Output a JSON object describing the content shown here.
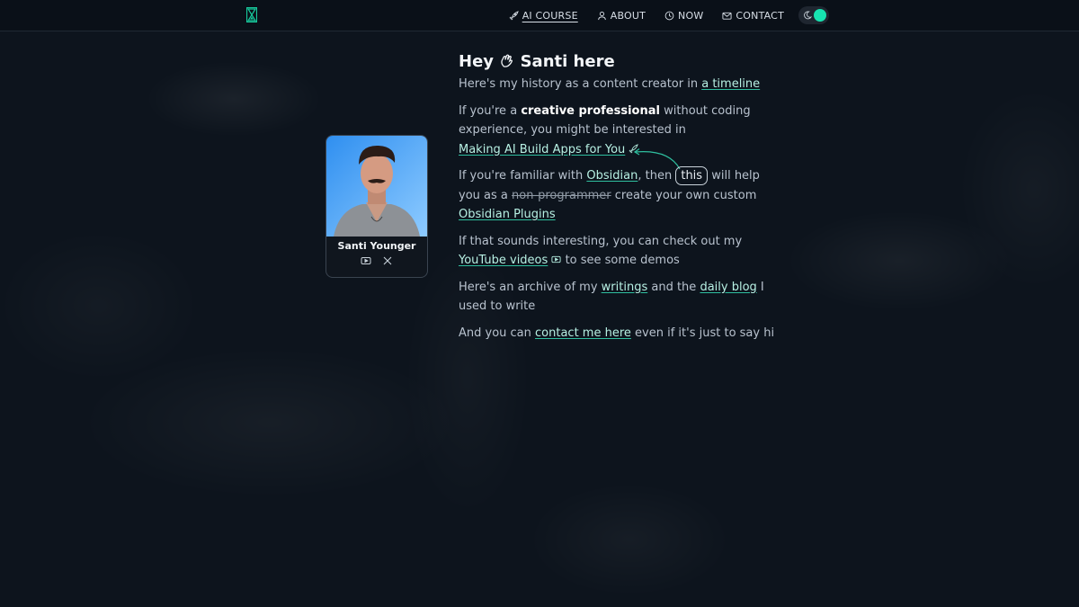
{
  "nav": {
    "items": [
      {
        "label": "AI COURSE",
        "icon": "rocket-icon"
      },
      {
        "label": "ABOUT",
        "icon": "user-icon"
      },
      {
        "label": "NOW",
        "icon": "clock-icon"
      },
      {
        "label": "CONTACT",
        "icon": "mail-icon"
      }
    ]
  },
  "theme_toggle": {
    "icon": "moon-icon",
    "accent": "#17e3b0"
  },
  "profile": {
    "name": "Santi Younger",
    "socials": [
      "youtube-icon",
      "x-icon"
    ]
  },
  "content": {
    "heading_pre": "Hey",
    "heading_post": "Santi here",
    "line1_text": "Here's my history as a content creator in",
    "line1_link": "a timeline",
    "p2_a": "If you're a",
    "p2_bold": "creative professional",
    "p2_b": "without coding experience, you might be interested in",
    "p2_link": "Making AI Build Apps for You",
    "p3_a": "If you're familiar with",
    "p3_link1": "Obsidian",
    "p3_b": ", then",
    "p3_circled": "this",
    "p3_c": "will help you as a",
    "p3_strike": "non-programmer",
    "p3_d": "create your own custom",
    "p3_link2": "Obsidian Plugins",
    "p4_a": "If that sounds interesting, you can check out my",
    "p4_link": "YouTube videos",
    "p4_b": "to see some demos",
    "p5_a": "Here's an archive of my",
    "p5_link1": "writings",
    "p5_b": "and the",
    "p5_link2": "daily blog",
    "p5_c": "I used to write",
    "p6_a": "And you can",
    "p6_link": "contact me here",
    "p6_b": "even if it's just to say hi"
  },
  "colors": {
    "background": "#0d141d",
    "accent": "#17e3b0",
    "link": "#b7f0e3"
  }
}
